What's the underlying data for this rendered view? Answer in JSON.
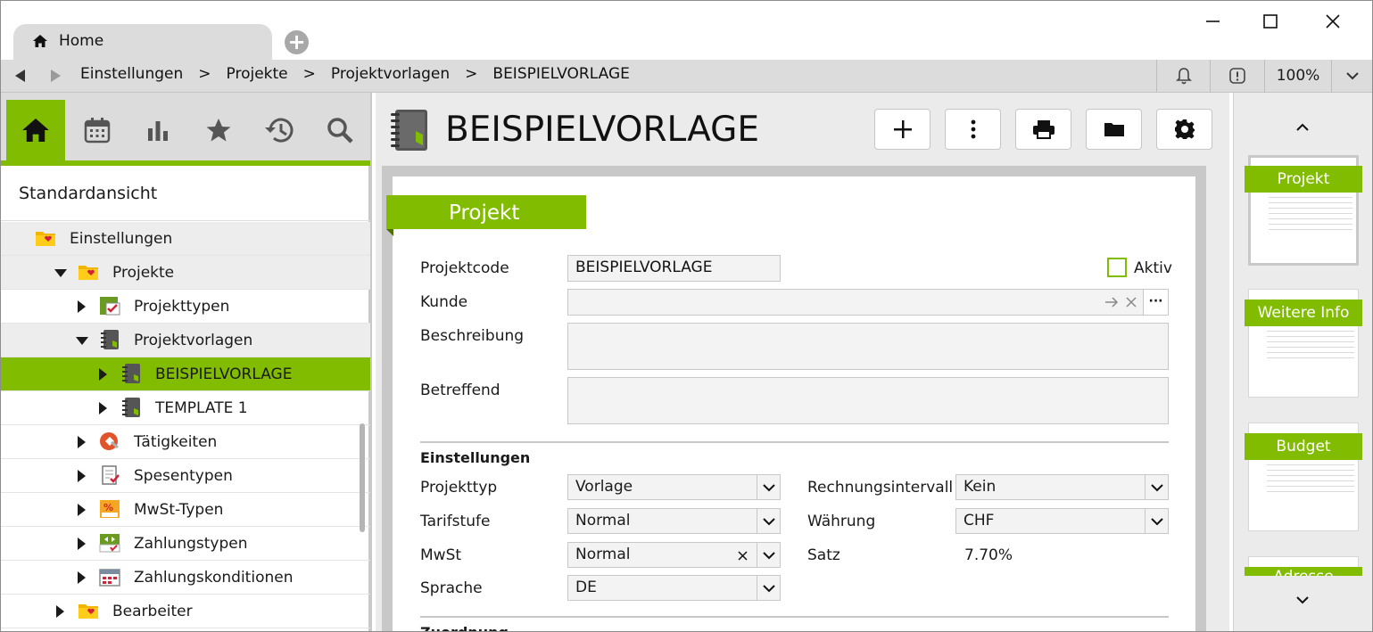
{
  "window": {
    "tab_label": "Home",
    "new_tab": "+"
  },
  "breadcrumb": {
    "items": [
      "Einstellungen",
      "Projekte",
      "Projektvorlagen",
      "BEISPIELVORLAGE"
    ],
    "separator": ">",
    "zoom": "100%"
  },
  "sidebar": {
    "view_title": "Standardansicht",
    "tree": [
      {
        "label": "Einstellungen",
        "level": 0,
        "state": "none",
        "icon": "folder-heart-icon"
      },
      {
        "label": "Projekte",
        "level": 1,
        "state": "expanded",
        "icon": "folder-heart-icon"
      },
      {
        "label": "Projekttypen",
        "level": 2,
        "state": "collapsed",
        "icon": "project-type-icon"
      },
      {
        "label": "Projektvorlagen",
        "level": 2,
        "state": "expanded",
        "icon": "notebook-icon"
      },
      {
        "label": "BEISPIELVORLAGE",
        "level": 3,
        "state": "collapsed",
        "icon": "notebook-icon",
        "selected": true
      },
      {
        "label": "TEMPLATE 1",
        "level": 3,
        "state": "collapsed",
        "icon": "notebook-icon"
      },
      {
        "label": "Tätigkeiten",
        "level": 2,
        "state": "collapsed",
        "icon": "activity-icon"
      },
      {
        "label": "Spesentypen",
        "level": 2,
        "state": "collapsed",
        "icon": "expense-type-icon"
      },
      {
        "label": "MwSt-Typen",
        "level": 2,
        "state": "collapsed",
        "icon": "vat-type-icon"
      },
      {
        "label": "Zahlungstypen",
        "level": 2,
        "state": "collapsed",
        "icon": "payment-type-icon"
      },
      {
        "label": "Zahlungskonditionen",
        "level": 2,
        "state": "collapsed",
        "icon": "payment-terms-icon"
      },
      {
        "label": "Bearbeiter",
        "level": 1,
        "state": "collapsed",
        "icon": "folder-heart-icon"
      }
    ]
  },
  "main": {
    "title": "BEISPIELVORLAGE",
    "section": "Projekt",
    "fields": {
      "projektcode_label": "Projektcode",
      "projektcode_value": "BEISPIELVORLAGE",
      "aktiv_label": "Aktiv",
      "kunde_label": "Kunde",
      "kunde_value": "",
      "kunde_more": "···",
      "beschreibung_label": "Beschreibung",
      "betreffend_label": "Betreffend"
    },
    "einstellungen": {
      "heading": "Einstellungen",
      "projekttyp_label": "Projekttyp",
      "projekttyp_value": "Vorlage",
      "tarifstufe_label": "Tarifstufe",
      "tarifstufe_value": "Normal",
      "mwst_label": "MwSt",
      "mwst_value": "Normal",
      "sprache_label": "Sprache",
      "sprache_value": "DE",
      "rechnungsintervall_label": "Rechnungsintervall",
      "rechnungsintervall_value": "Kein",
      "waehrung_label": "Währung",
      "waehrung_value": "CHF",
      "satz_label": "Satz",
      "satz_value": "7.70%"
    },
    "next_heading": "Zuordnung"
  },
  "thumbnails": [
    "Projekt",
    "Weitere Info",
    "Budget",
    "Adresse"
  ],
  "colors": {
    "accent": "#82bc00",
    "panel": "#dcdcdc"
  }
}
